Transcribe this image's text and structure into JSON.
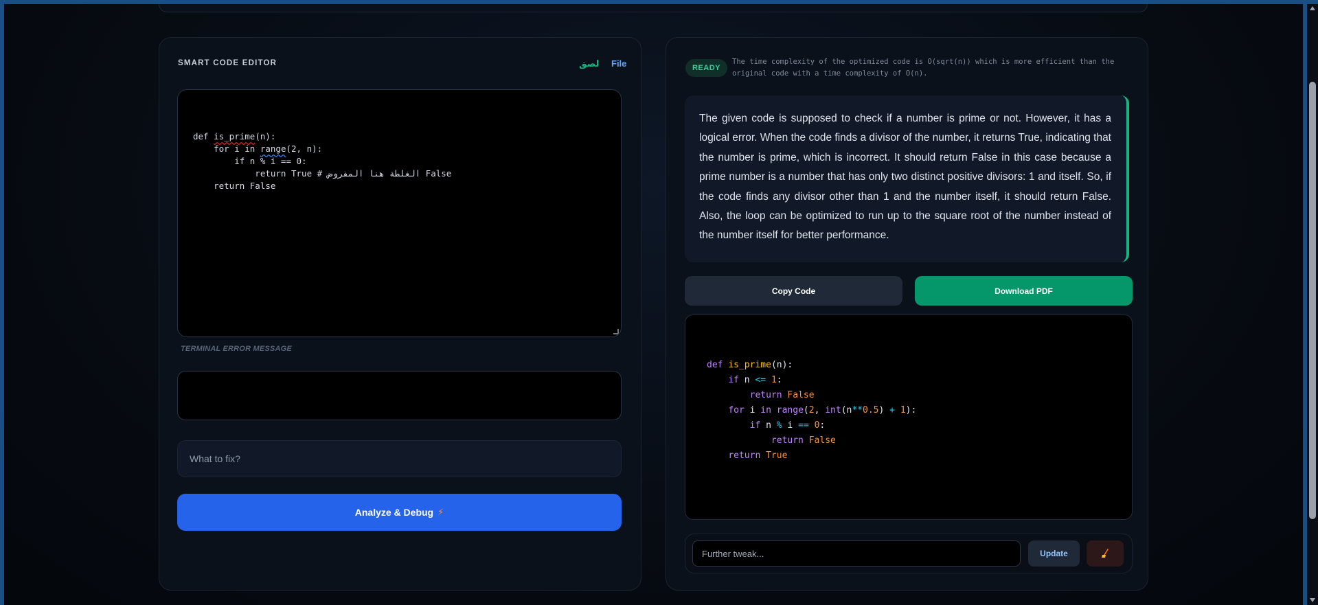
{
  "editor": {
    "title": "SMART CODE EDITOR",
    "paste_label": "لصق",
    "file_label": "File",
    "code_lines": [
      {
        "segments": [
          {
            "t": "def "
          },
          {
            "t": "is_prime",
            "cls": "err"
          },
          {
            "t": "(n):"
          }
        ]
      },
      {
        "segments": [
          {
            "t": "    for i in "
          },
          {
            "t": "range",
            "cls": "warn"
          },
          {
            "t": "(2, n):"
          }
        ]
      },
      {
        "segments": [
          {
            "t": "        if n % i == 0:"
          }
        ]
      },
      {
        "segments": [
          {
            "t": "            return True # الغلطة هنا المفروض False"
          }
        ]
      },
      {
        "segments": [
          {
            "t": "    return False"
          }
        ]
      }
    ],
    "terminal_label": "TERMINAL ERROR MESSAGE",
    "terminal_value": "",
    "fix_placeholder": "What to fix?",
    "analyze_label": "Analyze & Debug",
    "bolt_icon": "⚡"
  },
  "result": {
    "status": "READY",
    "complexity_note": "The time complexity of the optimized code is O(sqrt(n)) which is more efficient than the original code with a time complexity of O(n).",
    "explanation": "The given code is supposed to check if a number is prime or not. However, it has a logical error. When the code finds a divisor of the number, it returns True, indicating that the number is prime, which is incorrect. It should return False in this case because a prime number is a number that has only two distinct positive divisors: 1 and itself. So, if the code finds any divisor other than 1 and the number itself, it should return False. Also, the loop can be optimized to run up to the square root of the number instead of the number itself for better performance.",
    "copy_label": "Copy Code",
    "pdf_label": "Download PDF",
    "output_lines": [
      [
        {
          "t": "def ",
          "cls": "kw"
        },
        {
          "t": "is_prime",
          "cls": "fn"
        },
        {
          "t": "(n):"
        }
      ],
      [
        {
          "t": "    "
        },
        {
          "t": "if ",
          "cls": "kw"
        },
        {
          "t": "n "
        },
        {
          "t": "<=",
          "cls": "op"
        },
        {
          "t": " "
        },
        {
          "t": "1",
          "cls": "num"
        },
        {
          "t": ":"
        }
      ],
      [
        {
          "t": "        "
        },
        {
          "t": "return ",
          "cls": "kw"
        },
        {
          "t": "False",
          "cls": "bool"
        }
      ],
      [
        {
          "t": "    "
        },
        {
          "t": "for ",
          "cls": "kw"
        },
        {
          "t": "i "
        },
        {
          "t": "in ",
          "cls": "kw"
        },
        {
          "t": "range",
          "cls": "kw"
        },
        {
          "t": "("
        },
        {
          "t": "2",
          "cls": "num"
        },
        {
          "t": ", "
        },
        {
          "t": "int",
          "cls": "kw"
        },
        {
          "t": "(n"
        },
        {
          "t": "**",
          "cls": "op"
        },
        {
          "t": "0.5",
          "cls": "num"
        },
        {
          "t": ") "
        },
        {
          "t": "+",
          "cls": "op"
        },
        {
          "t": " "
        },
        {
          "t": "1",
          "cls": "num"
        },
        {
          "t": "):"
        }
      ],
      [
        {
          "t": "        "
        },
        {
          "t": "if ",
          "cls": "kw"
        },
        {
          "t": "n "
        },
        {
          "t": "%",
          "cls": "op"
        },
        {
          "t": " i "
        },
        {
          "t": "==",
          "cls": "op"
        },
        {
          "t": " "
        },
        {
          "t": "0",
          "cls": "num"
        },
        {
          "t": ":"
        }
      ],
      [
        {
          "t": "            "
        },
        {
          "t": "return ",
          "cls": "kw"
        },
        {
          "t": "False",
          "cls": "bool"
        }
      ],
      [
        {
          "t": "    "
        },
        {
          "t": "return ",
          "cls": "kw"
        },
        {
          "t": "True",
          "cls": "bool"
        }
      ]
    ],
    "tweak_placeholder": "Further tweak...",
    "update_label": "Update",
    "broom_icon": "broom-icon"
  }
}
